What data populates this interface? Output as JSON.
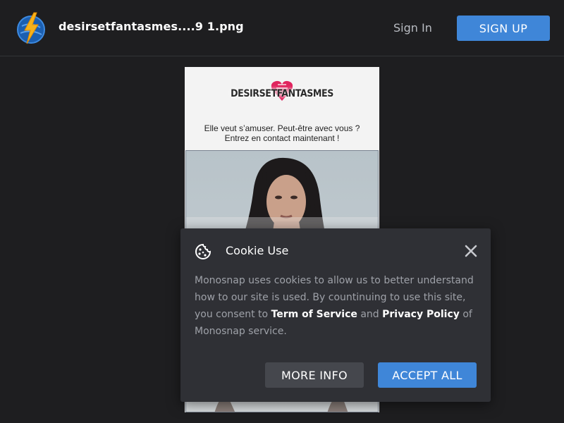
{
  "header": {
    "filename": "desirsetfantasmes....9 1.png",
    "sign_in_label": "Sign In",
    "sign_up_label": "SIGN UP"
  },
  "preview": {
    "brand_name": "DESIRSETFANTASMES",
    "tagline_line1": "Elle veut s’amuser. Peut-être avec vous ?",
    "tagline_line2": "Entrez en contact maintenant !"
  },
  "cookie_dialog": {
    "title": "Cookie Use",
    "body_before": "Monosnap uses cookies to allow us to better understand how to our site is used. By countinuing to use this site, you consent to ",
    "terms_link": "Term of Service",
    "and_text": " and ",
    "privacy_link": "Privacy Policy",
    "body_after": " of Monosnap service.",
    "more_info_label": "MORE INFO",
    "accept_label": "ACCEPT ALL"
  },
  "colors": {
    "accent": "#3f86d8",
    "background": "#1e1e20",
    "dialog": "#2f3035"
  },
  "icons": {
    "logo": "lightning-globe-icon",
    "cookie": "cookie-icon",
    "close": "close-icon"
  }
}
